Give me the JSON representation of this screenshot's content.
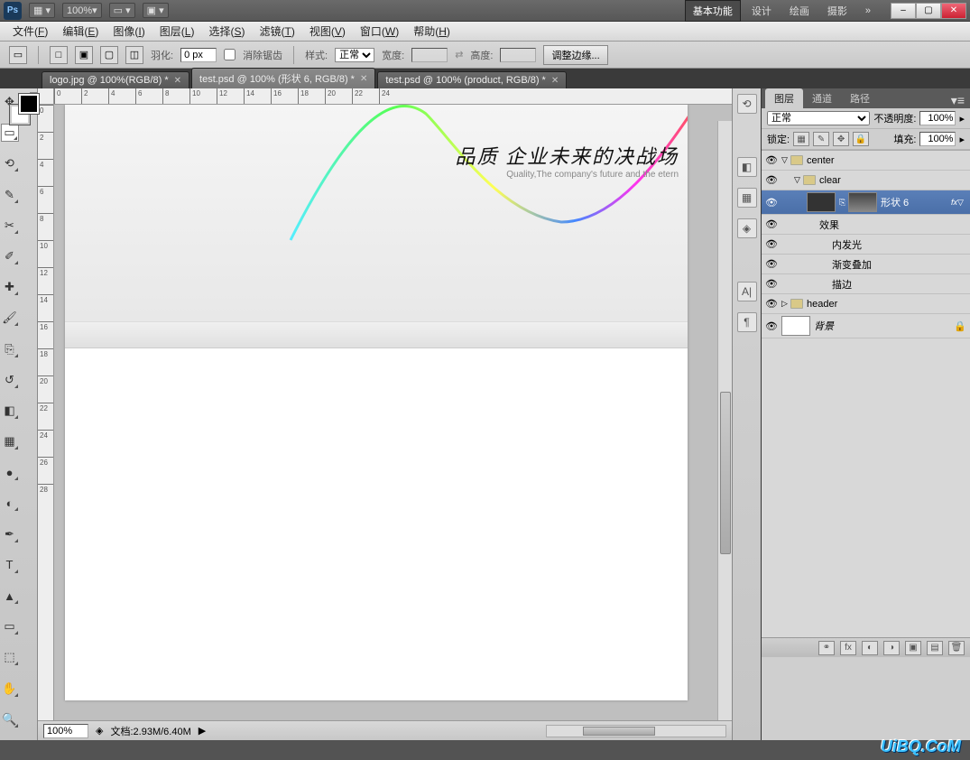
{
  "topbar": {
    "logo": "Ps",
    "zoom": "100%",
    "workspaces": [
      "基本功能",
      "设计",
      "绘画",
      "摄影"
    ],
    "active_workspace": "基本功能",
    "expand": "»"
  },
  "menu": {
    "items": [
      {
        "label": "文件",
        "accel": "F"
      },
      {
        "label": "编辑",
        "accel": "E"
      },
      {
        "label": "图像",
        "accel": "I"
      },
      {
        "label": "图层",
        "accel": "L"
      },
      {
        "label": "选择",
        "accel": "S"
      },
      {
        "label": "滤镜",
        "accel": "T"
      },
      {
        "label": "视图",
        "accel": "V"
      },
      {
        "label": "窗口",
        "accel": "W"
      },
      {
        "label": "帮助",
        "accel": "H"
      }
    ]
  },
  "options": {
    "feather_label": "羽化:",
    "feather_value": "0 px",
    "antialias": "消除锯齿",
    "style_label": "样式:",
    "style_value": "正常",
    "width_label": "宽度:",
    "height_label": "高度:",
    "refine_edge": "调整边缘..."
  },
  "tabs": [
    {
      "title": "logo.jpg @ 100%(RGB/8) *",
      "active": false
    },
    {
      "title": "test.psd @ 100% (形状 6, RGB/8) *",
      "active": true
    },
    {
      "title": "test.psd @ 100% (product, RGB/8) *",
      "active": false
    }
  ],
  "ruler_h": [
    0,
    2,
    4,
    6,
    8,
    10,
    12,
    14,
    16,
    18,
    20,
    22,
    24
  ],
  "ruler_v": [
    0,
    2,
    4,
    6,
    8,
    10,
    12,
    14,
    16,
    18,
    20,
    22,
    24,
    26,
    28
  ],
  "canvas": {
    "hero_title": "品质 企业未来的决战场",
    "hero_sub": "Quality,The company's future and the etern"
  },
  "panels": {
    "tabs": [
      "图层",
      "通道",
      "路径"
    ],
    "active_tab": "图层",
    "blend_mode": "正常",
    "opacity_label": "不透明度:",
    "opacity_value": "100%",
    "lock_label": "锁定:",
    "fill_label": "填充:",
    "fill_value": "100%"
  },
  "layers": {
    "center": "center",
    "clear": "clear",
    "shape6": "形状 6",
    "fx": "fx",
    "effects": "效果",
    "inner_glow": "内发光",
    "grad_overlay": "渐变叠加",
    "stroke": "描边",
    "header": "header",
    "background": "背景"
  },
  "status": {
    "zoom": "100%",
    "doc_label": "文档:",
    "doc_size": "2.93M/6.40M"
  },
  "watermark": "UiBQ.CoM"
}
